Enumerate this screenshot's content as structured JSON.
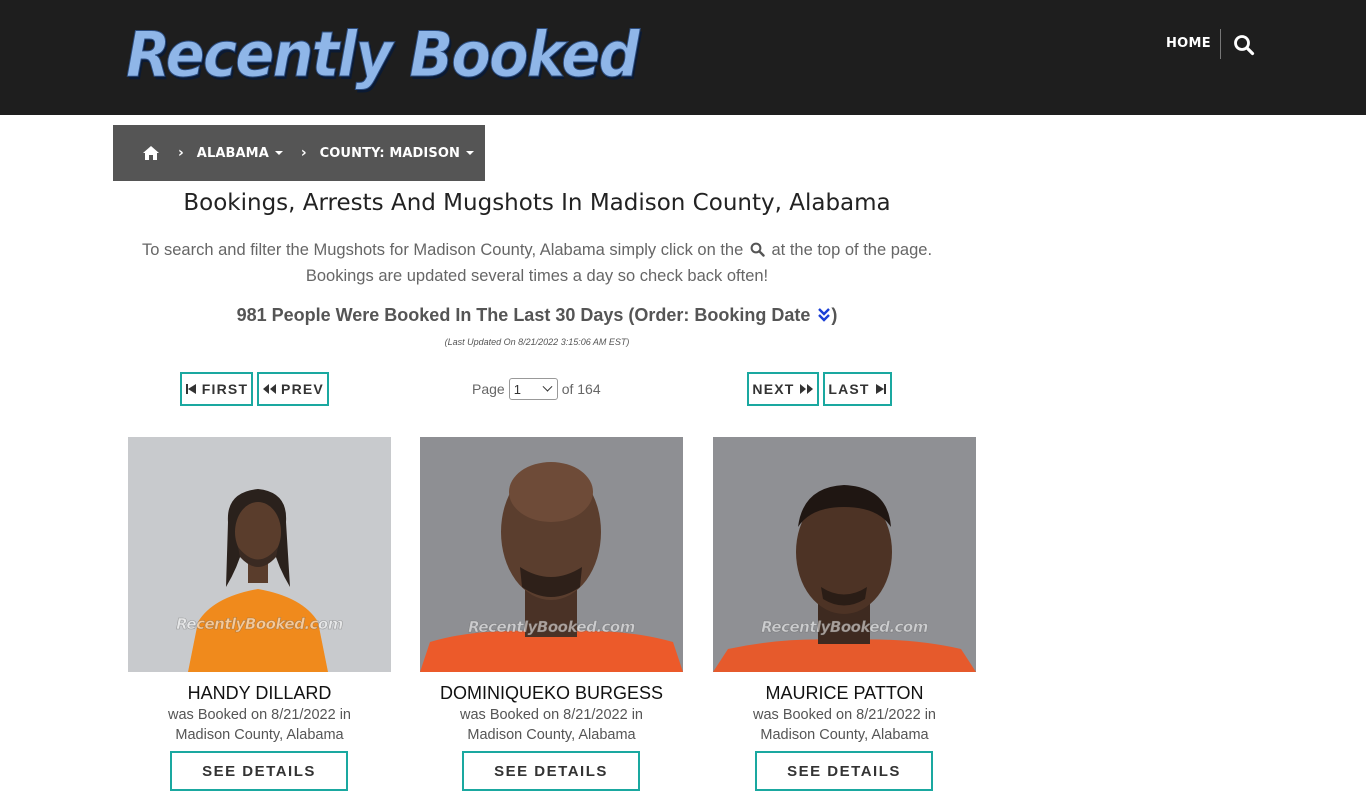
{
  "header": {
    "logo_text": "Recently Booked",
    "nav_home": "HOME",
    "search_icon": "search-icon"
  },
  "breadcrumb": {
    "home_icon": "home-icon",
    "items": [
      {
        "label": "ALABAMA"
      },
      {
        "label": "COUNTY: MADISON"
      }
    ]
  },
  "main": {
    "title": "Bookings, Arrests And Mugshots In Madison County, Alabama",
    "intro_part1": "To search and filter the Mugshots for Madison County, Alabama simply click on the",
    "intro_part2": "at the top of the page.",
    "intro_line2": "Bookings are updated several times a day so check back often!",
    "count_text": "981 People Were Booked In The Last 30 Days (Order: Booking Date",
    "count_close": ")",
    "updated": "(Last Updated On 8/21/2022 3:15:06 AM EST)"
  },
  "pagination": {
    "first": "FIRST",
    "prev": "PREV",
    "next": "NEXT",
    "last": "LAST",
    "page_label": "Page",
    "current_page": "1",
    "of_label": "of 164"
  },
  "colors": {
    "header_bg": "#1e1e1e",
    "breadcrumb_bg": "#555555",
    "accent_teal": "#1aa8a0",
    "order_icon": "#1a3fd6"
  },
  "watermark": "RecentlyBooked.com",
  "bookings": [
    {
      "name": "HANDY DILLARD",
      "line1": "was Booked on 8/21/2022 in",
      "line2": "Madison County, Alabama",
      "button": "SEE DETAILS"
    },
    {
      "name": "DOMINIQUEKO BURGESS",
      "line1": "was Booked on 8/21/2022 in",
      "line2": "Madison County, Alabama",
      "button": "SEE DETAILS"
    },
    {
      "name": "MAURICE PATTON",
      "line1": "was Booked on 8/21/2022 in",
      "line2": "Madison County, Alabama",
      "button": "SEE DETAILS"
    }
  ]
}
